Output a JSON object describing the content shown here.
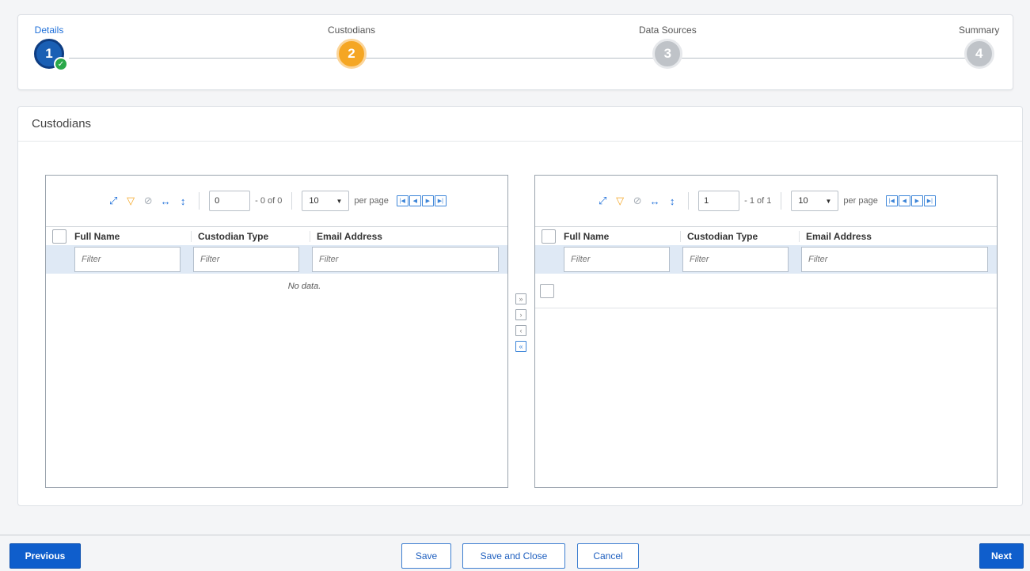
{
  "wizard": {
    "steps": [
      {
        "label": "Details",
        "number": "1",
        "state": "done"
      },
      {
        "label": "Custodians",
        "number": "2",
        "state": "current"
      },
      {
        "label": "Data Sources",
        "number": "3",
        "state": "pending"
      },
      {
        "label": "Summary",
        "number": "4",
        "state": "pending"
      }
    ],
    "check_glyph": "✓"
  },
  "panel": {
    "title": "Custodians"
  },
  "left_grid": {
    "page_value": "0",
    "page_of": "- 0 of 0",
    "per_page_value": "10",
    "per_page_label": "per page",
    "columns": [
      "Full Name",
      "Custodian Type",
      "Email Address"
    ],
    "filter_placeholder": "Filter",
    "empty_message": "No data."
  },
  "right_grid": {
    "page_value": "1",
    "page_of": "- 1 of 1",
    "per_page_value": "10",
    "per_page_label": "per page",
    "columns": [
      "Full Name",
      "Custodian Type",
      "Email Address"
    ],
    "filter_placeholder": "Filter"
  },
  "toolbar_icons": [
    "expand-icon",
    "filter-icon",
    "clear-filter-icon",
    "fit-columns-icon",
    "fit-rows-icon"
  ],
  "transfer_icons": [
    "move-all-right-icon",
    "move-right-icon",
    "move-left-icon",
    "move-all-left-icon"
  ],
  "footer": {
    "previous": "Previous",
    "save": "Save",
    "save_close": "Save and Close",
    "cancel": "Cancel",
    "next": "Next"
  },
  "colors": {
    "primary": "#0f5ecc",
    "step_done": "#1a5fb4",
    "step_current": "#f5a623",
    "step_pending": "#bfc3c8",
    "check": "#2aa84a"
  }
}
